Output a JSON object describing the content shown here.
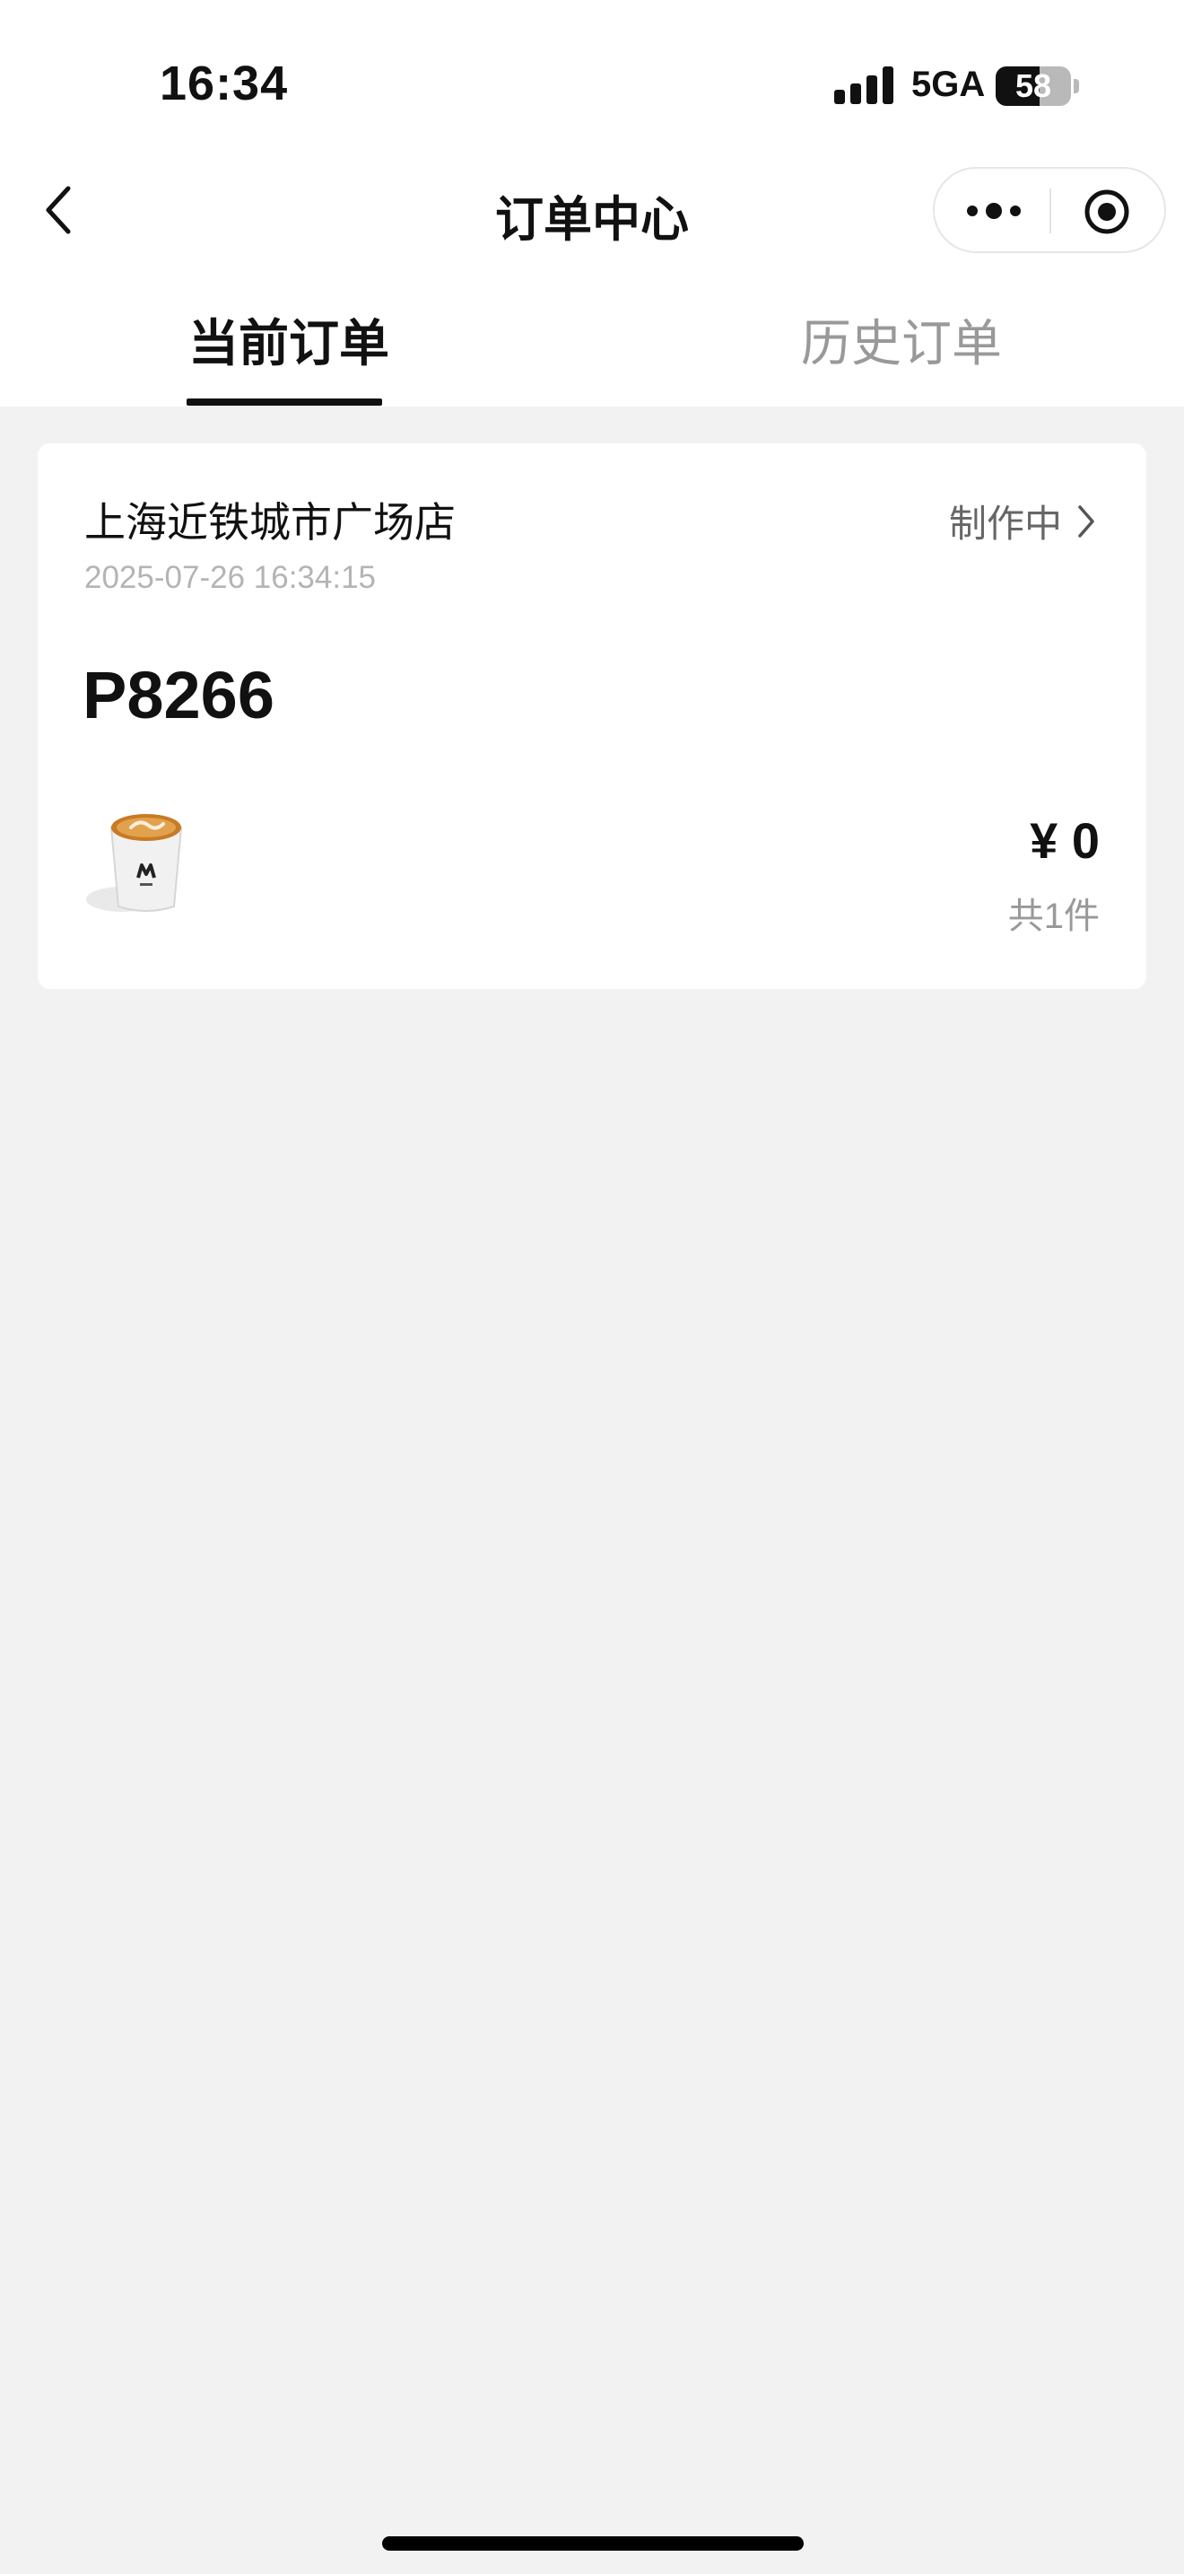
{
  "status_bar": {
    "time": "16:34",
    "network": "5GA",
    "battery_level": "58",
    "battery_fraction": 0.58
  },
  "nav": {
    "title": "订单中心",
    "back_icon": "chevron-left-icon",
    "more_icon": "more-dots-icon",
    "close_icon": "target-circle-icon"
  },
  "tabs": [
    {
      "label": "当前订单",
      "active": true
    },
    {
      "label": "历史订单",
      "active": false
    }
  ],
  "order": {
    "store_name": "上海近铁城市广场店",
    "time": "2025-07-26 16:34:15",
    "status": "制作中",
    "pickup_code": "P8266",
    "price": "¥ 0",
    "item_count": "共1件",
    "product_icon": "coffee-cup-icon"
  },
  "colors": {
    "background": "#f2f2f2",
    "card": "#ffffff",
    "text_primary": "#111111",
    "text_secondary": "#999999",
    "accent_latte": "#d08a2a"
  }
}
